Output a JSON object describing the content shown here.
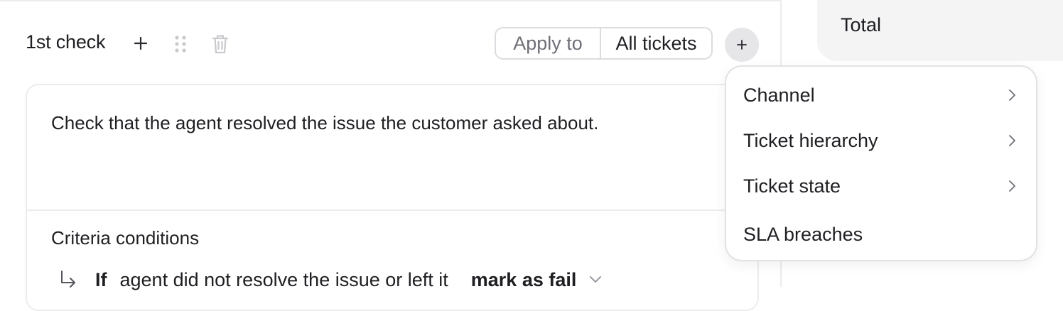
{
  "check": {
    "title": "1st check",
    "apply_to_label": "Apply to",
    "apply_to_value": "All tickets"
  },
  "card": {
    "description": "Check that the agent resolved the issue the customer asked about.",
    "criteria_title": "Criteria conditions",
    "condition": {
      "if_label": "If",
      "condition_text": "agent did not resolve the issue or left it",
      "action_text": "mark as fail"
    }
  },
  "summary": {
    "total_label": "Total"
  },
  "dropdown": {
    "items": [
      {
        "label": "Channel",
        "has_submenu": true
      },
      {
        "label": "Ticket hierarchy",
        "has_submenu": true
      },
      {
        "label": "Ticket state",
        "has_submenu": true
      },
      {
        "label": "SLA breaches",
        "has_submenu": false
      }
    ]
  },
  "icons": {
    "add": "plus-icon",
    "drag": "drag-handle-icon",
    "delete": "trash-icon",
    "add_filter": "plus-icon",
    "condition": "return-arrow-icon",
    "expand": "chevron-down-icon",
    "submenu": "chevron-right-icon"
  },
  "colors": {
    "text": "#1f1f23",
    "muted": "#6f6f78",
    "border": "#dcdce0",
    "panel_bg": "#f4f4f5",
    "plus_circle_bg": "#e6e6e9"
  }
}
